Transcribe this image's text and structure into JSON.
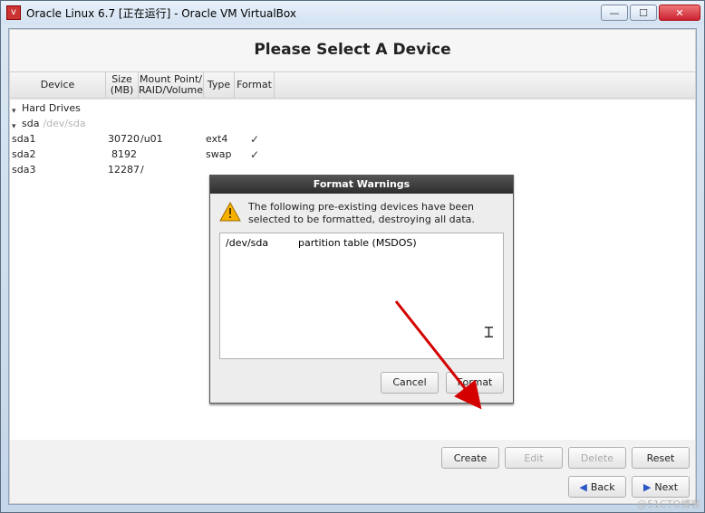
{
  "window": {
    "title": "Oracle Linux 6.7 [正在运行] - Oracle VM VirtualBox"
  },
  "heading": "Please Select A Device",
  "columns": {
    "device": "Device",
    "size": "Size (MB)",
    "mount": "Mount Point/ RAID/Volume",
    "type": "Type",
    "format": "Format"
  },
  "tree": {
    "root": "Hard Drives",
    "disk": {
      "name": "sda",
      "hint": "/dev/sda"
    },
    "partitions": [
      {
        "name": "sda1",
        "size": "30720",
        "mount": "/u01",
        "type": "ext4",
        "format": true
      },
      {
        "name": "sda2",
        "size": "8192",
        "mount": "",
        "type": "swap",
        "format": true
      },
      {
        "name": "sda3",
        "size": "12287",
        "mount": "/",
        "type": "",
        "format": false
      }
    ]
  },
  "crud": {
    "create": "Create",
    "edit": "Edit",
    "delete": "Delete",
    "reset": "Reset"
  },
  "nav": {
    "back": "Back",
    "next": "Next"
  },
  "dialog": {
    "title": "Format Warnings",
    "message": "The following pre-existing devices have been selected to be formatted, destroying all data.",
    "items": [
      {
        "dev": "/dev/sda",
        "desc": "partition table (MSDOS)"
      }
    ],
    "cancel": "Cancel",
    "format": "Format"
  },
  "watermark": "@51CTO博客"
}
